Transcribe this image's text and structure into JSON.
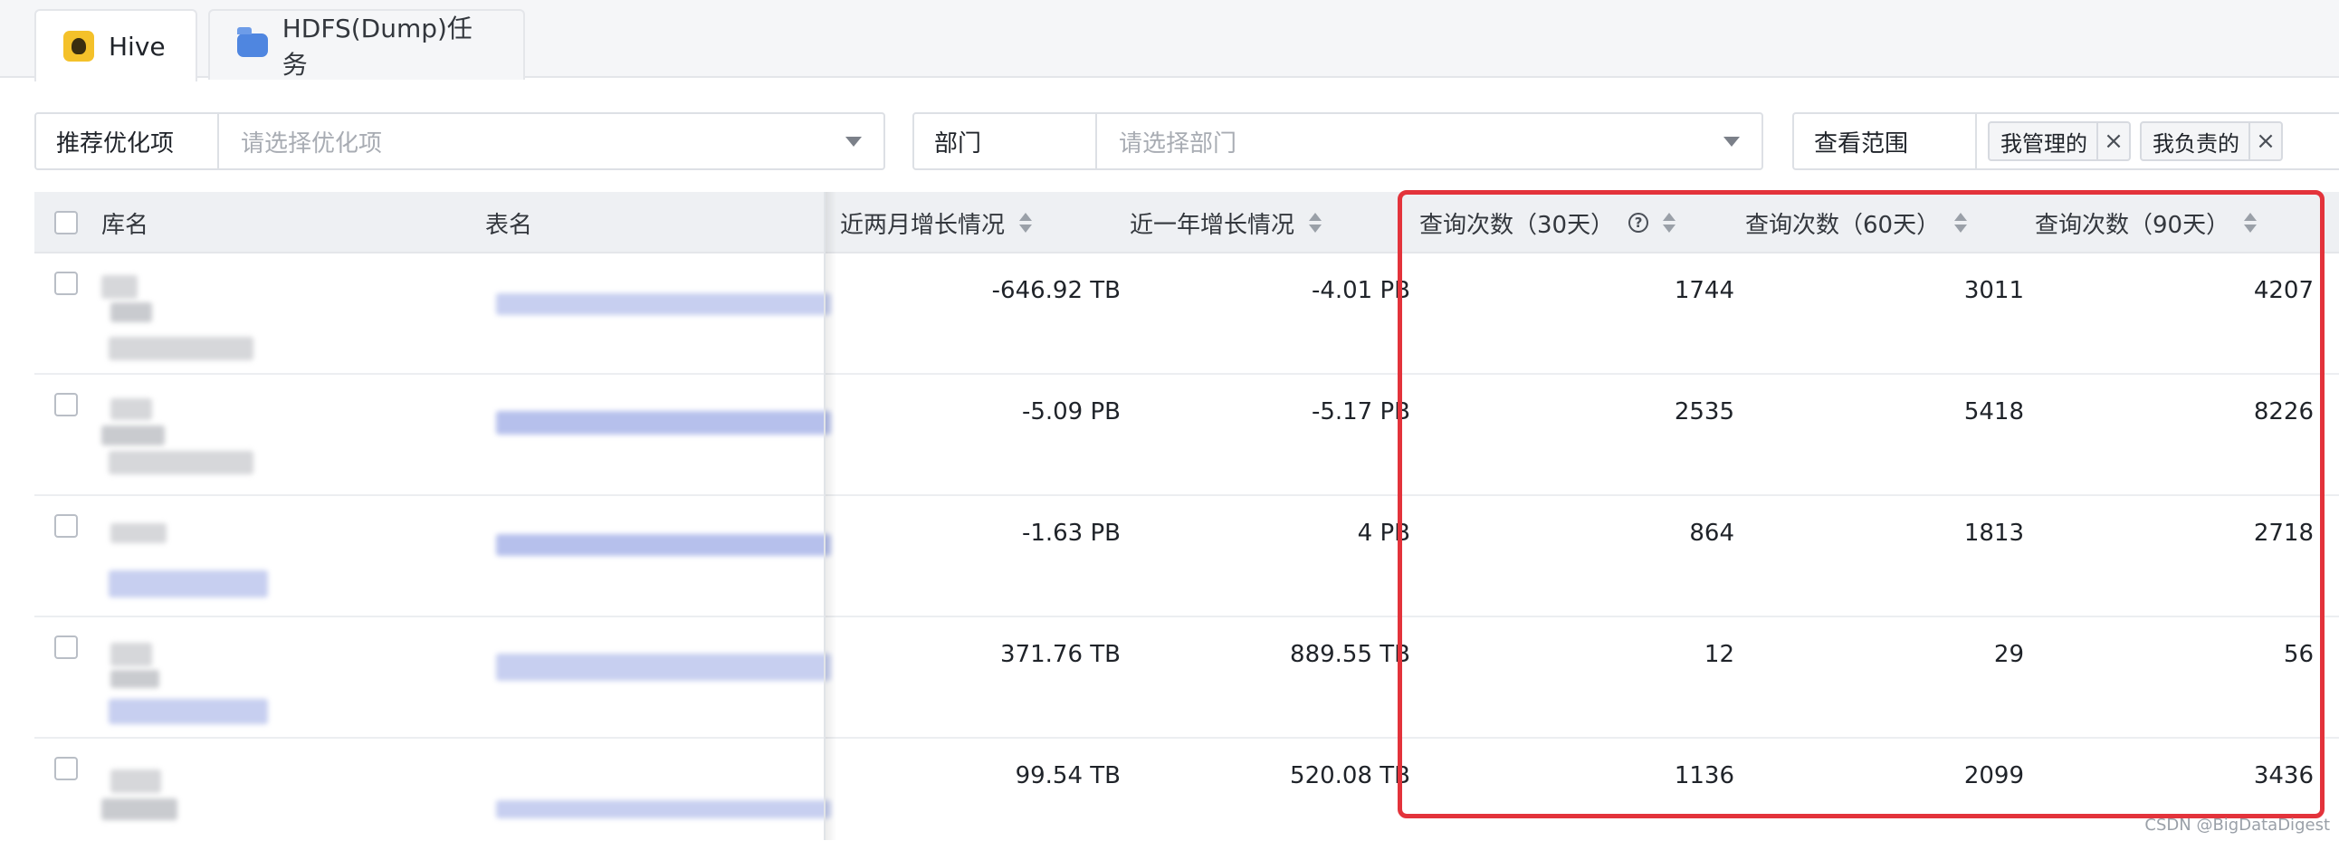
{
  "tabs": [
    {
      "label": "Hive",
      "icon": "hive-icon",
      "active": true
    },
    {
      "label": "HDFS(Dump)任务",
      "icon": "folder-icon",
      "active": false
    }
  ],
  "filters": {
    "recommend": {
      "label": "推荐优化项",
      "placeholder": "请选择优化项"
    },
    "department": {
      "label": "部门",
      "placeholder": "请选择部门"
    },
    "scope": {
      "label": "查看范围",
      "tags": [
        "我管理的",
        "我负责的"
      ],
      "remove_glyph": "×"
    }
  },
  "table": {
    "columns": {
      "db": "库名",
      "table": "表名",
      "growth_2m": "近两月增长情况",
      "growth_1y": "近一年增长情况",
      "q30": "查询次数（30天）",
      "q60": "查询次数（60天）",
      "q90": "查询次数（90天）"
    },
    "rows": [
      {
        "growth_2m": "-646.92 TB",
        "growth_1y": "-4.01 PB",
        "q30": "1744",
        "q60": "3011",
        "q90": "4207"
      },
      {
        "growth_2m": "-5.09 PB",
        "growth_1y": "-5.17 PB",
        "q30": "2535",
        "q60": "5418",
        "q90": "8226"
      },
      {
        "growth_2m": "-1.63 PB",
        "growth_1y": "4 PB",
        "q30": "864",
        "q60": "1813",
        "q90": "2718"
      },
      {
        "growth_2m": "371.76 TB",
        "growth_1y": "889.55 TB",
        "q30": "12",
        "q60": "29",
        "q90": "56"
      },
      {
        "growth_2m": "99.54 TB",
        "growth_1y": "520.08 TB",
        "q30": "1136",
        "q60": "2099",
        "q90": "3436"
      }
    ]
  },
  "colors": {
    "highlight": "#e3333b",
    "header_bg": "#eef0f3"
  },
  "credit": "CSDN @BigDataDigest"
}
